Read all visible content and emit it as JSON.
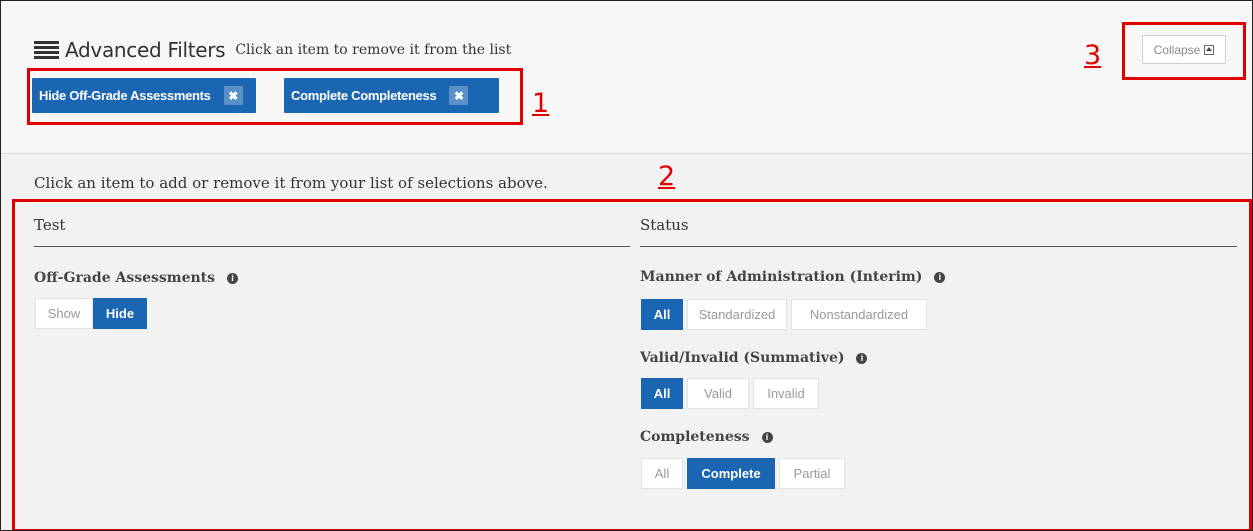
{
  "header": {
    "title": "Advanced Filters",
    "hint": "Click an item to remove it from the list",
    "collapse_label": "Collapse",
    "chips": [
      {
        "label": "Hide Off-Grade Assessments",
        "remove": "✖"
      },
      {
        "label": "Complete Completeness",
        "remove": "✖"
      }
    ]
  },
  "annotations": {
    "one": "1",
    "two": "2",
    "three": "3"
  },
  "annotation_color": "#e00000",
  "accent_color": "#1a66b3",
  "main": {
    "instruction": "Click an item to add or remove it from your list of selections above.",
    "test": {
      "heading": "Test",
      "off_grade": {
        "label": "Off-Grade Assessments",
        "options": [
          "Show",
          "Hide"
        ],
        "selected": "Hide"
      }
    },
    "status": {
      "heading": "Status",
      "manner": {
        "label": "Manner of Administration (Interim)",
        "options": [
          "All",
          "Standardized",
          "Nonstandardized"
        ],
        "selected": "All"
      },
      "valid": {
        "label": "Valid/Invalid (Summative)",
        "options": [
          "All",
          "Valid",
          "Invalid"
        ],
        "selected": "All"
      },
      "completeness": {
        "label": "Completeness",
        "options": [
          "All",
          "Complete",
          "Partial"
        ],
        "selected": "Complete"
      }
    },
    "info_icon": "info-icon"
  }
}
